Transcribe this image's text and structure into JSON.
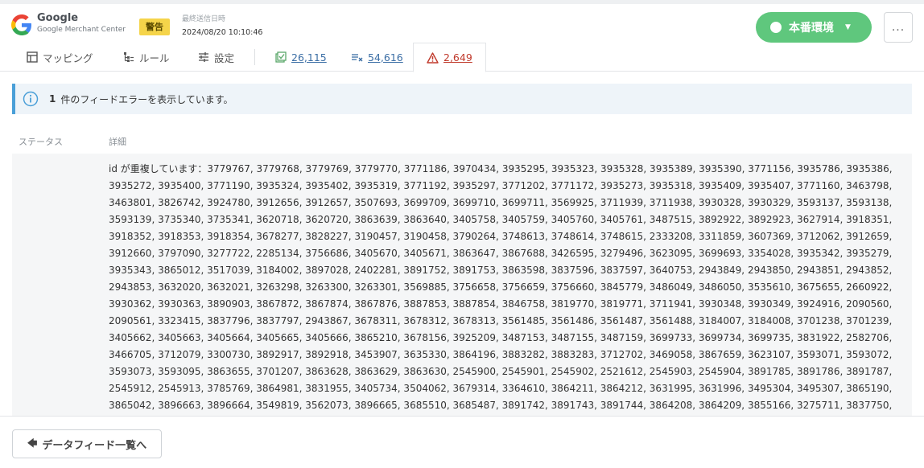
{
  "header": {
    "brand_name": "Google",
    "brand_sub": "Google Merchant Center",
    "badge": "警告",
    "sent_label": "最終送信日時",
    "sent_value": "2024/08/20 10:10:46",
    "env_button": "本番環境",
    "more_label": "..."
  },
  "tabs": [
    {
      "label": "マッピング",
      "icon": "mapping-icon"
    },
    {
      "label": "ルール",
      "icon": "rules-icon"
    },
    {
      "label": "設定",
      "icon": "settings-icon"
    },
    {
      "label": "26,115",
      "icon": "valid-items-icon"
    },
    {
      "label": "54,616",
      "icon": "excluded-items-icon"
    },
    {
      "label": "2,649",
      "icon": "warning-icon"
    }
  ],
  "colors": {
    "accent_green": "#5fc77d",
    "badge_yellow": "#f5d44a",
    "link_blue": "#3b6ea5",
    "warning_red": "#c0392b",
    "info_blue": "#4a9fd8"
  },
  "notice": {
    "count": "1",
    "text": "件のフィードエラーを表示しています。"
  },
  "table": {
    "col_status": "ステータス",
    "col_detail": "詳細",
    "detail": "id が重複しています：3779767, 3779768, 3779769, 3779770, 3771186, 3970434, 3935295, 3935323, 3935328, 3935389, 3935390, 3771156, 3935786, 3935386, 3935272, 3935400, 3771190, 3935324, 3935402, 3935319, 3771192, 3935297, 3771202, 3771172, 3935273, 3935318, 3935409, 3935407, 3771160, 3463798, 3463801, 3826742, 3924780, 3912656, 3912657, 3507693, 3699709, 3699710, 3699711, 3569925, 3711939, 3711938, 3930328, 3930329, 3593137, 3593138, 3593139, 3735340, 3735341, 3620718, 3620720, 3863639, 3863640, 3405758, 3405759, 3405760, 3405761, 3487515, 3892922, 3892923, 3627914, 3918351, 3918352, 3918353, 3918354, 3678277, 3828227, 3190457, 3190458, 3790264, 3748613, 3748614, 3748615, 2333208, 3311859, 3607369, 3712062, 3912659, 3912660, 3797090, 3277722, 2285134, 3756686, 3405670, 3405671, 3863647, 3867688, 3426595, 3279496, 3623095, 3699693, 3354028, 3935342, 3935279, 3935343, 3865012, 3517039, 3184002, 3897028, 2402281, 3891752, 3891753, 3863598, 3837596, 3837597, 3640753, 2943849, 2943850, 2943851, 2943852, 2943853, 3632020, 3632021, 3263298, 3263300, 3263301, 3569885, 3756658, 3756659, 3756660, 3845779, 3486049, 3486050, 3535610, 3675655, 2660922, 3930362, 3930363, 3890903, 3867872, 3867874, 3867876, 3887853, 3887854, 3846758, 3819770, 3819771, 3711941, 3930348, 3930349, 3924916, 2090560, 2090561, 3323415, 3837796, 3837797, 2943867, 3678311, 3678312, 3678313, 3561485, 3561486, 3561487, 3561488, 3184007, 3184008, 3701238, 3701239, 3405662, 3405663, 3405664, 3405665, 3405666, 3865210, 3678156, 3925209, 3487153, 3487155, 3487159, 3699733, 3699734, 3699735, 3831922, 2582706, 3466705, 3712079, 3300730, 3892917, 3892918, 3453907, 3635330, 3864196, 3883282, 3883283, 3712702, 3469058, 3867659, 3623107, 3593071, 3593072, 3593073, 3593095, 3863655, 3701207, 3863628, 3863629, 3863630, 2545900, 2545901, 2545902, 2521612, 2545903, 2545904, 3891785, 3891786, 3891787, 2545912, 2545913, 3785769, 3864981, 3831955, 3405734, 3504062, 3679314, 3364610, 3864211, 3864212, 3631995, 3631996, 3495304, 3495307, 3865190, 3865042, 3896663, 3896664, 3549819, 3562073, 3896665, 3685510, 3685487, 3891742, 3891743, 3891744, 3864208, 3864209, 3855166, 3275711, 3837750,"
  },
  "footer": {
    "back_button": "データフィード一覧へ"
  }
}
